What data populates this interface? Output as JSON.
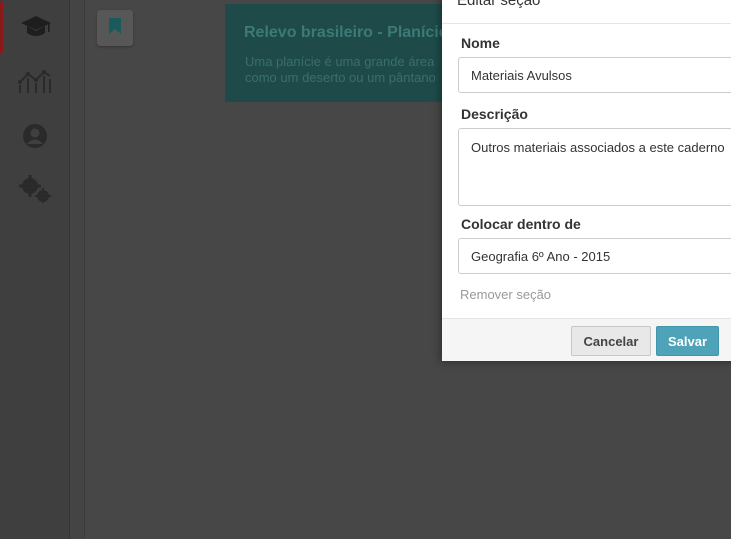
{
  "sidebar": {
    "items": [
      {
        "icon": "graduation-cap-icon",
        "active": true
      },
      {
        "icon": "chart-icon",
        "active": false
      },
      {
        "icon": "user-icon",
        "active": false
      },
      {
        "icon": "gears-icon",
        "active": false
      }
    ]
  },
  "toolbar": {
    "bookmark_icon": "bookmark-icon"
  },
  "banner": {
    "title": "Relevo brasileiro - Planície",
    "text": "Uma planície é uma grande área como um deserto ou um pântano"
  },
  "modal": {
    "title": "Editar seção",
    "name_label": "Nome",
    "name_value": "Materiais Avulsos",
    "description_label": "Descrição",
    "description_value": "Outros materiais associados a este caderno",
    "parent_label": "Colocar dentro de",
    "parent_value": "Geografia 6º Ano - 2015",
    "remove_label": "Remover seção",
    "cancel_label": "Cancelar",
    "save_label": "Salvar"
  },
  "colors": {
    "accent": "#4fa3b8",
    "sidebar_active": "#8a1a1a",
    "banner_bg": "#1e4b49"
  }
}
